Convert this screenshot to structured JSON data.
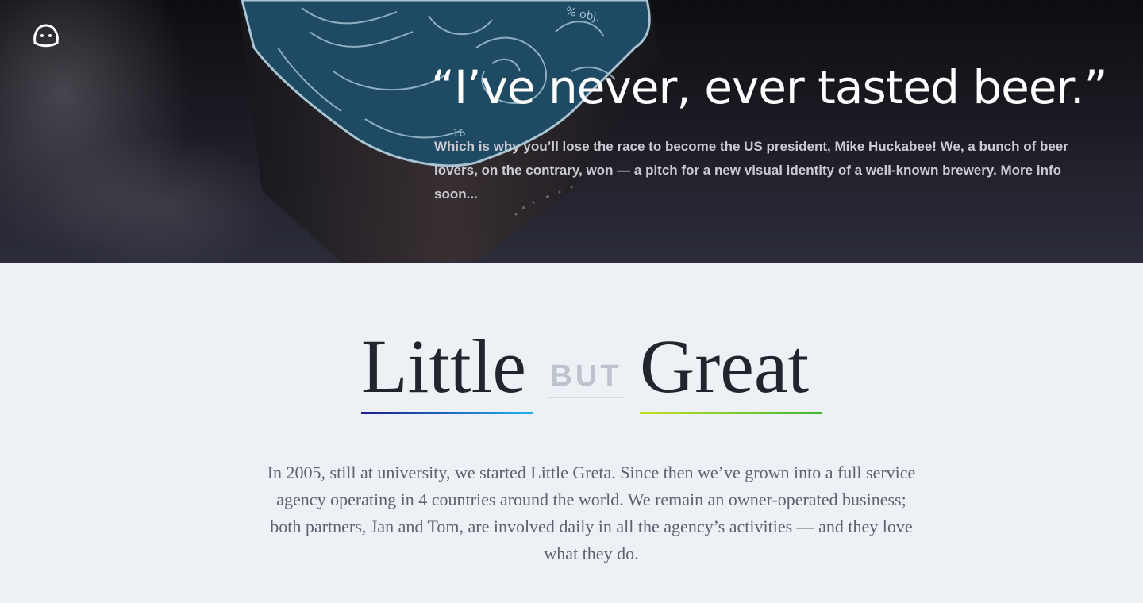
{
  "hero": {
    "quote": "“I’ve never, ever tasted beer.”",
    "text": "Which is why you’ll lose the race to become the US president, Mike Huckabee! We, a bunch of beer lovers, on the contrary, won — a pitch for a new visual identity of a well-known brewery. More info soon...",
    "label_text_1": "% obj.",
    "label_text_2": "16",
    "icon": "smiley-face-logo-icon"
  },
  "about": {
    "headline": {
      "word_1": "Little",
      "connector": "BUT",
      "word_2": "Great"
    },
    "intro": "In 2005, still at university, we started Little Greta. Since then we’ve grown into a full service agency operating in 4 countries around the world. We remain an owner-operated business; both partners, Jan and Tom, are involved daily in all the agency’s activities — and they love what they do."
  },
  "colors": {
    "background": "#edf1f5",
    "text_dark": "#23252d",
    "accent_blue": "#1fb4ec",
    "accent_navy": "#1c1a8e",
    "accent_green": "#3fb733",
    "accent_lime": "#c5e021"
  }
}
